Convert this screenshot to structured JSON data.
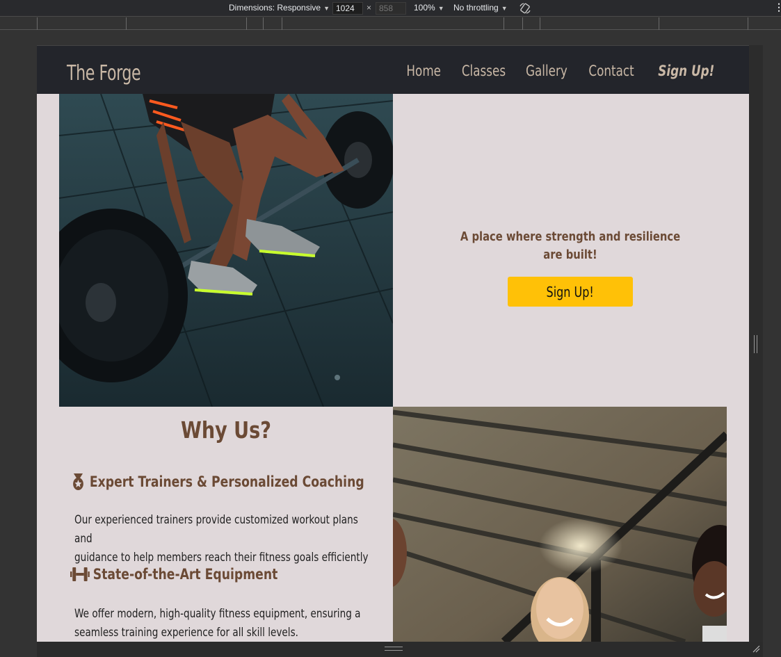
{
  "devtools": {
    "dimensions_label": "Dimensions: Responsive",
    "width_value": "1024",
    "height_placeholder": "858",
    "times": "×",
    "zoom": "100%",
    "throttling": "No throttling",
    "more": "⋮"
  },
  "site": {
    "brand": "The Forge",
    "nav": [
      "Home",
      "Classes",
      "Gallery",
      "Contact",
      "Sign Up!"
    ],
    "hero": {
      "tagline_line1": "A place where strength and resilience",
      "tagline_line2": "are built!",
      "cta": "Sign Up!"
    },
    "why": {
      "title": "Why Us?",
      "features": [
        {
          "icon": "medal-icon",
          "title": "Expert Trainers & Personalized Coaching",
          "line1": "Our experienced trainers provide customized workout plans and",
          "line2": "guidance to help members reach their fitness goals efficiently"
        },
        {
          "icon": "dumbbell-icon",
          "title": "State-of-the-Art Equipment",
          "line1": "We offer modern, high-quality fitness equipment, ensuring a",
          "line2": "seamless training experience for all skill levels."
        }
      ]
    }
  },
  "colors": {
    "nav_bg": "#23252b",
    "brand": "#c9b8a6",
    "accent_brown": "#6b4a35",
    "page_bg": "#e0d8da",
    "cta_bg": "#ffc107"
  }
}
